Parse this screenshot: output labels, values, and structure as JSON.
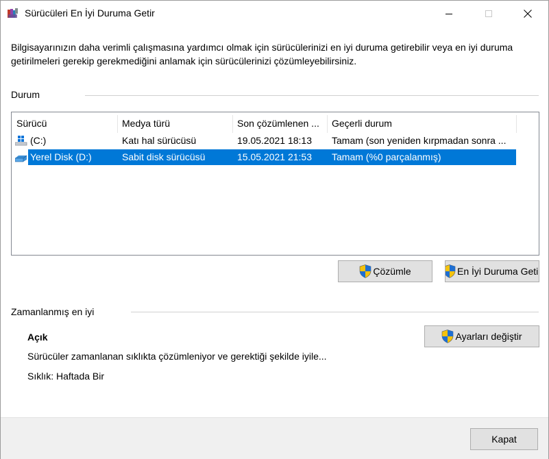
{
  "window": {
    "title": "Sürücüleri En İyi Duruma Getir",
    "description": "Bilgisayarınızın daha verimli çalışmasına yardımcı olmak için sürücülerinizi en iyi duruma getirebilir veya en iyi duruma getirilmeleri gerekip gerekmediğini anlamak için sürücülerinizi çözümleyebilirsiniz."
  },
  "status_group": {
    "label": "Durum"
  },
  "table": {
    "columns": [
      "Sürücü",
      "Medya türü",
      "Son çözümlenen ...",
      "Geçerli durum"
    ],
    "rows": [
      {
        "drive": "(C:)",
        "media": "Katı hal sürücüsü",
        "last": "19.05.2021 18:13",
        "status": "Tamam (son yeniden kırpmadan sonra ...",
        "selected": false
      },
      {
        "drive": "Yerel Disk (D:)",
        "media": "Sabit disk sürücüsü",
        "last": "15.05.2021 21:53",
        "status": "Tamam (%0 parçalanmış)",
        "selected": true
      }
    ]
  },
  "buttons": {
    "analyze": "Çözümle",
    "optimize": "En İyi Duruma Geti",
    "change_settings": "Ayarları değiştir",
    "close": "Kapat"
  },
  "scheduled": {
    "label": "Zamanlanmış en iyi",
    "state": "Açık",
    "description": "Sürücüler zamanlanan sıklıkta çözümleniyor ve gerektiği şekilde iyile...",
    "frequency": "Sıklık: Haftada Bir"
  },
  "colors": {
    "selection": "#0078d7",
    "button_face": "#e1e1e1",
    "footer": "#f0f0f0"
  }
}
